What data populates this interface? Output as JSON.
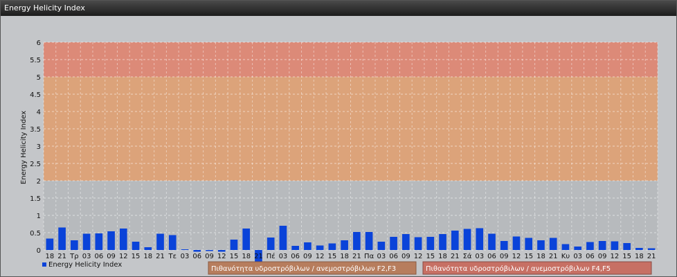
{
  "window": {
    "title": "Energy Helicity Index"
  },
  "colors": {
    "bar": "#0a43d9",
    "band_low": "#b7babd",
    "band_mid": "#dca37a",
    "band_high": "#dc8a78",
    "band_note_f2f3": "#b77d5d",
    "band_note_f4f5": "#c77064"
  },
  "band_notes": {
    "f2f3": "Πιθανότητα υδροστρόβιλων / ανεμοστρόβιλων F2,F3",
    "f4f5": "Πιθανότητα υδροστρόβιλων / ανεμοστρόβιλων F4,F5"
  },
  "chart_data": {
    "type": "bar",
    "title": "",
    "xlabel": "",
    "ylabel": "Energy Helicity Index",
    "ylim": [
      0,
      6
    ],
    "yticks": [
      "0",
      "0.5",
      "1",
      "1.5",
      "2",
      "2.5",
      "3",
      "3.5",
      "4",
      "4.5",
      "5",
      "5.5",
      "6"
    ],
    "grid": true,
    "legend": "bottom-left",
    "bands": [
      {
        "from": 0,
        "to": 2,
        "color": "#b7babd"
      },
      {
        "from": 2,
        "to": 5,
        "color": "#dca37a"
      },
      {
        "from": 5,
        "to": 6,
        "color": "#dc8a78"
      }
    ],
    "categories": [
      "18",
      "21",
      "Τρ",
      "03",
      "06",
      "09",
      "12",
      "15",
      "18",
      "21",
      "Τε",
      "03",
      "06",
      "09",
      "12",
      "15",
      "18",
      "21",
      "Πέ",
      "03",
      "06",
      "09",
      "12",
      "15",
      "18",
      "21",
      "Πα",
      "03",
      "06",
      "09",
      "12",
      "15",
      "18",
      "21",
      "Σά",
      "03",
      "06",
      "09",
      "12",
      "15",
      "18",
      "21",
      "Κυ",
      "03",
      "06",
      "09",
      "12",
      "15",
      "18",
      "21"
    ],
    "series": [
      {
        "name": "Energy Helicity Index",
        "values": [
          0.33,
          0.65,
          0.28,
          0.47,
          0.48,
          0.54,
          0.62,
          0.24,
          0.08,
          0.47,
          0.43,
          0.02,
          -0.05,
          -0.03,
          -0.05,
          0.3,
          0.62,
          -0.55,
          0.36,
          0.7,
          0.12,
          0.22,
          0.13,
          0.19,
          0.28,
          0.52,
          0.52,
          0.24,
          0.38,
          0.46,
          0.37,
          0.38,
          0.46,
          0.56,
          0.61,
          0.63,
          0.47,
          0.26,
          0.39,
          0.35,
          0.28,
          0.35,
          0.17,
          0.1,
          0.23,
          0.26,
          0.25,
          0.2,
          0.06,
          0.05
        ]
      }
    ]
  }
}
